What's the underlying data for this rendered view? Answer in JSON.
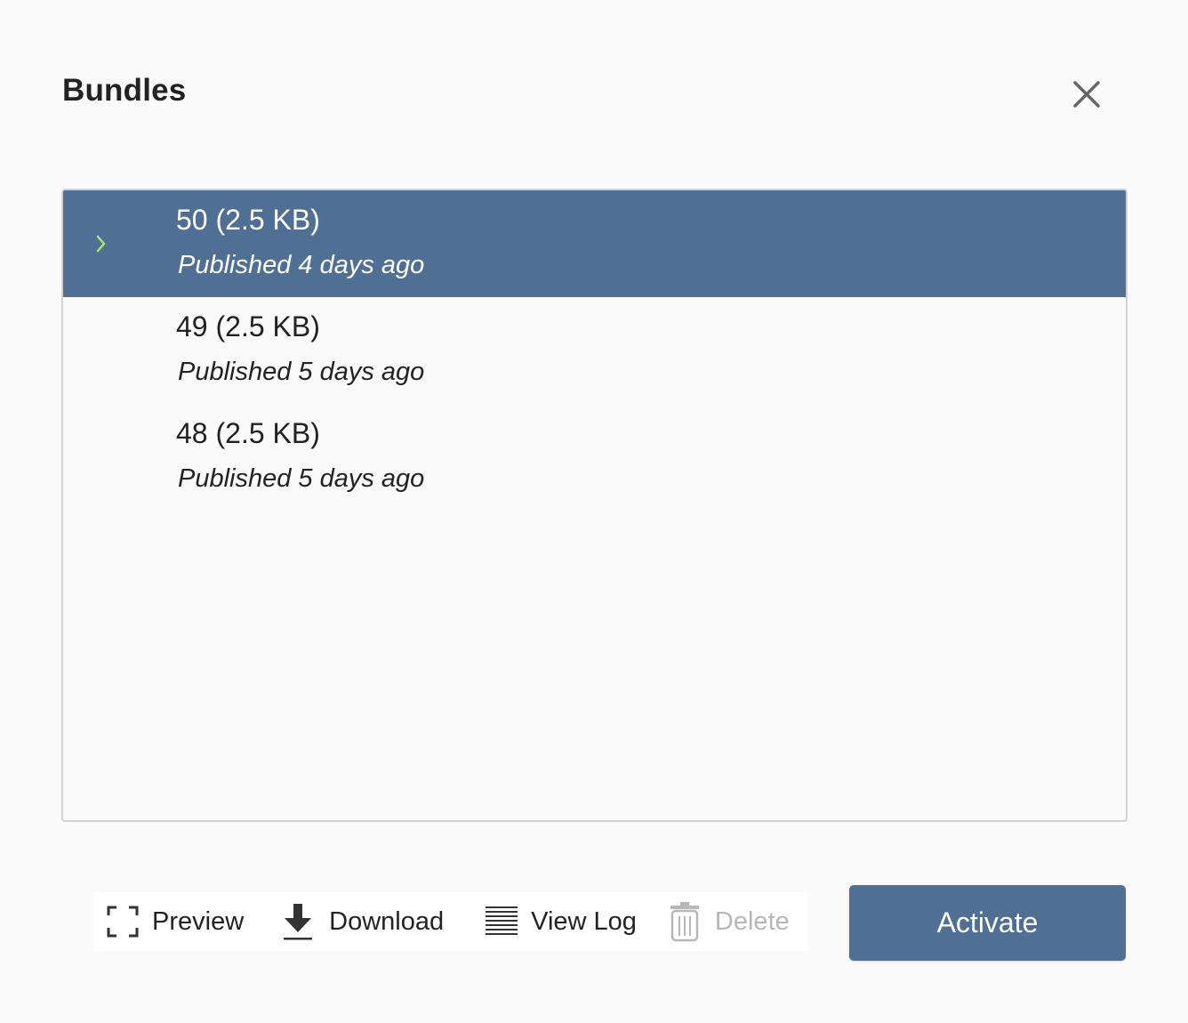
{
  "dialog": {
    "title": "Bundles",
    "close_icon": "close-icon"
  },
  "bundles": [
    {
      "name": "50 (2.5 KB)",
      "published": "Published 4 days ago",
      "selected": true
    },
    {
      "name": "49 (2.5 KB)",
      "published": "Published 5 days ago",
      "selected": false
    },
    {
      "name": "48 (2.5 KB)",
      "published": "Published 5 days ago",
      "selected": false
    }
  ],
  "toolbar": {
    "preview_label": "Preview",
    "download_label": "Download",
    "view_log_label": "View Log",
    "delete_label": "Delete",
    "delete_disabled": true
  },
  "activate_label": "Activate",
  "colors": {
    "accent": "#4f6f95",
    "chevron": "#a8e06a",
    "disabled_text": "#b7b7b7"
  }
}
